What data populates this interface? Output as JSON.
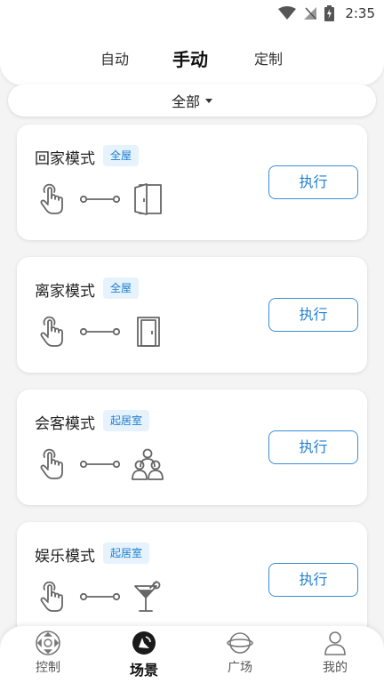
{
  "status_bar": {
    "time": "2:35",
    "icons": [
      "wifi-icon",
      "no-signal-icon",
      "battery-charging-icon"
    ]
  },
  "tabs": [
    {
      "label": "自动",
      "active": false
    },
    {
      "label": "手动",
      "active": true
    },
    {
      "label": "定制",
      "active": false
    }
  ],
  "filter": {
    "label": "全部",
    "icon": "caret-down-icon"
  },
  "scenes": [
    {
      "title": "回家模式",
      "tag": "全屋",
      "trigger_icon": "touch-icon",
      "target_icon": "door-open-icon",
      "button": "执行"
    },
    {
      "title": "离家模式",
      "tag": "全屋",
      "trigger_icon": "touch-icon",
      "target_icon": "door-closed-icon",
      "button": "执行"
    },
    {
      "title": "会客模式",
      "tag": "起居室",
      "trigger_icon": "touch-icon",
      "target_icon": "people-icon",
      "button": "执行"
    },
    {
      "title": "娱乐模式",
      "tag": "起居室",
      "trigger_icon": "touch-icon",
      "target_icon": "cocktail-icon",
      "button": "执行"
    }
  ],
  "bottom_nav": [
    {
      "label": "控制",
      "icon": "dpad-icon",
      "active": false
    },
    {
      "label": "场景",
      "icon": "scene-icon",
      "active": true
    },
    {
      "label": "广场",
      "icon": "planet-icon",
      "active": false
    },
    {
      "label": "我的",
      "icon": "user-icon",
      "active": false
    }
  ],
  "colors": {
    "accent": "#1f7fd0",
    "badge_bg": "#e6f2fc",
    "background": "#f4f4f4"
  }
}
